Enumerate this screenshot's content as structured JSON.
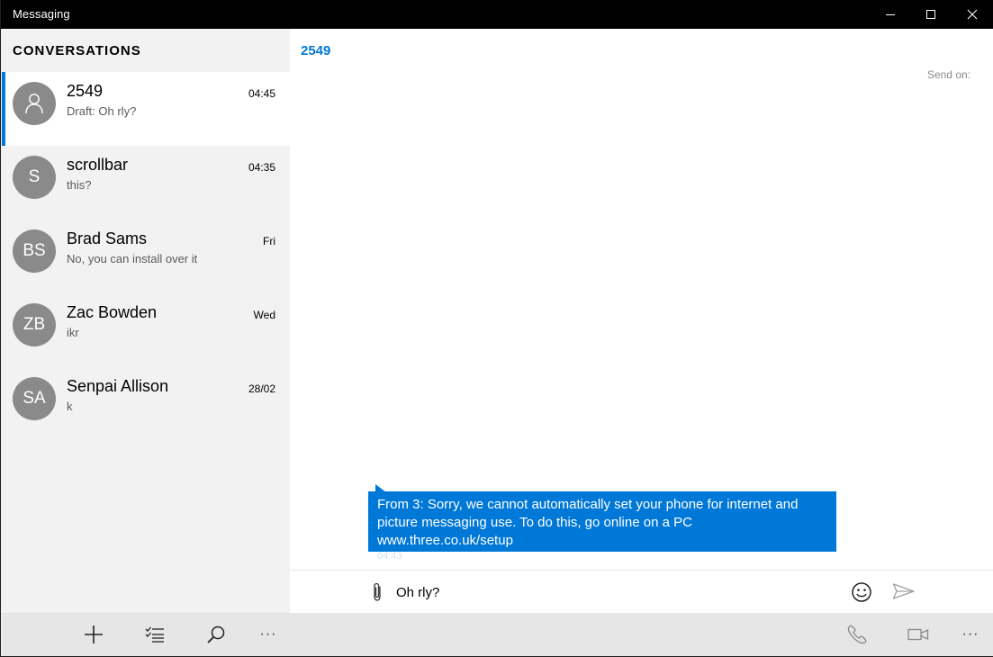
{
  "window": {
    "title": "Messaging"
  },
  "sidebar": {
    "header": "CONVERSATIONS",
    "conversations": [
      {
        "initials": "",
        "name": "2549",
        "preview": "Draft: Oh rly?",
        "time": "04:45",
        "selected": true
      },
      {
        "initials": "S",
        "name": "scrollbar",
        "preview": "this?",
        "time": "04:35",
        "selected": false
      },
      {
        "initials": "BS",
        "name": "Brad Sams",
        "preview": "No, you can install over it",
        "time": "Fri",
        "selected": false
      },
      {
        "initials": "ZB",
        "name": "Zac Bowden",
        "preview": "ikr",
        "time": "Wed",
        "selected": false
      },
      {
        "initials": "SA",
        "name": "Senpai Allison",
        "preview": "k",
        "time": "28/02",
        "selected": false
      }
    ]
  },
  "thread": {
    "title": "2549",
    "send_on_label": "Send on:",
    "messages": [
      {
        "text": "From 3: Sorry, we cannot automatically set your phone for internet and picture messaging use. To do this, go online on a PC www.three.co.uk/setup",
        "time": "04:43"
      }
    ]
  },
  "compose": {
    "value": "Oh rly?"
  },
  "appbar": {
    "more_label": "···"
  },
  "colors": {
    "accent": "#0078d7",
    "titlebar": "#000000",
    "sidebar_bg": "#f2f2f2",
    "avatar_bg": "#8a8a8a"
  },
  "icons": {
    "minimize": "minimize-icon",
    "maximize": "maximize-icon",
    "close": "close-icon",
    "person": "person-icon",
    "attach": "paperclip-icon",
    "emoji": "emoji-icon",
    "send": "send-icon",
    "new": "plus-icon",
    "select": "checklist-icon",
    "search": "search-icon",
    "call": "phone-icon",
    "video": "video-icon",
    "more": "more-icon"
  }
}
